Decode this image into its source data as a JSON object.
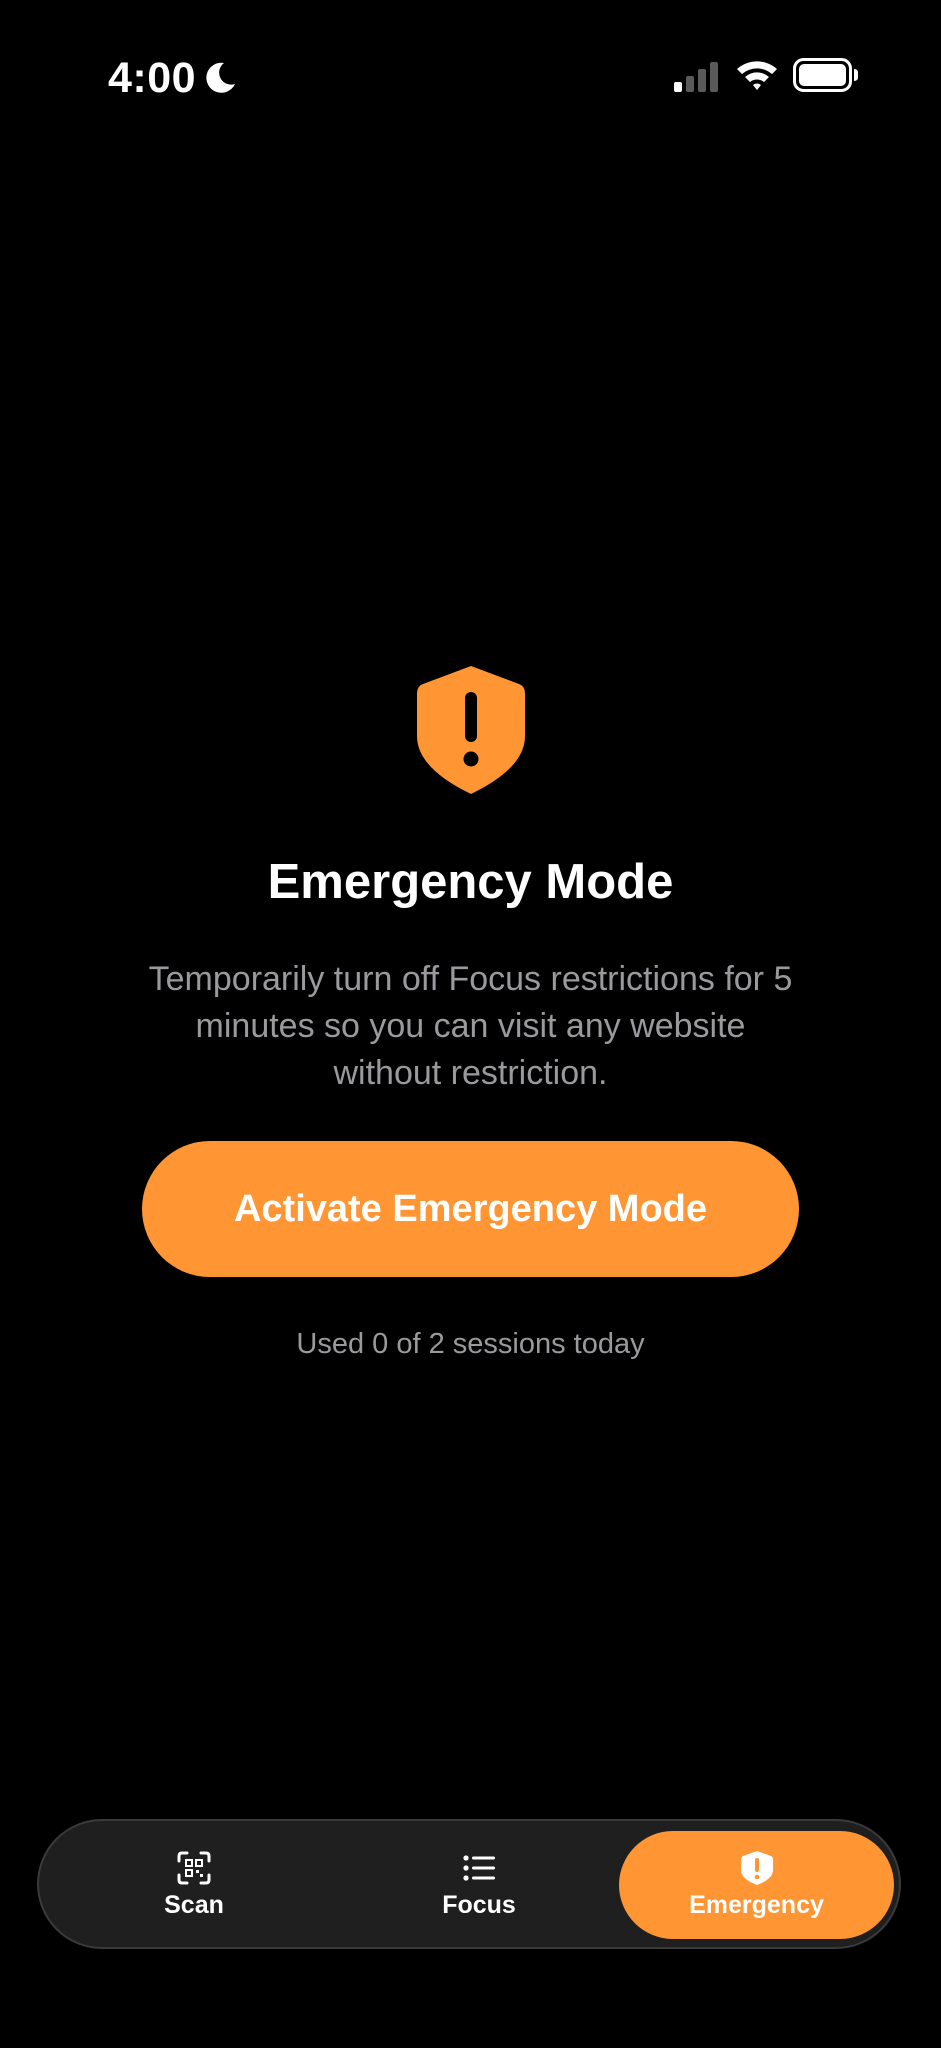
{
  "status_bar": {
    "time": "4:00",
    "icons": [
      "moon-icon",
      "cellular-signal-icon",
      "wifi-icon",
      "battery-icon"
    ]
  },
  "main": {
    "hero_icon": "shield-exclamation-icon",
    "title": "Emergency Mode",
    "description": "Temporarily turn off Focus restrictions for 5 minutes so you can visit any website without restriction.",
    "activate_label": "Activate Emergency Mode",
    "usage": "Used 0 of 2 sessions today"
  },
  "tab_bar": {
    "tabs": [
      {
        "label": "Scan",
        "icon": "qr-scan-icon",
        "selected": false
      },
      {
        "label": "Focus",
        "icon": "list-icon",
        "selected": false
      },
      {
        "label": "Emergency",
        "icon": "shield-exclamation-icon",
        "selected": true
      }
    ]
  },
  "colors": {
    "background": "#000000",
    "accent": "#ff9533",
    "secondary_text": "#9a9a9e",
    "tab_bar_bg": "#1f1f1f"
  }
}
